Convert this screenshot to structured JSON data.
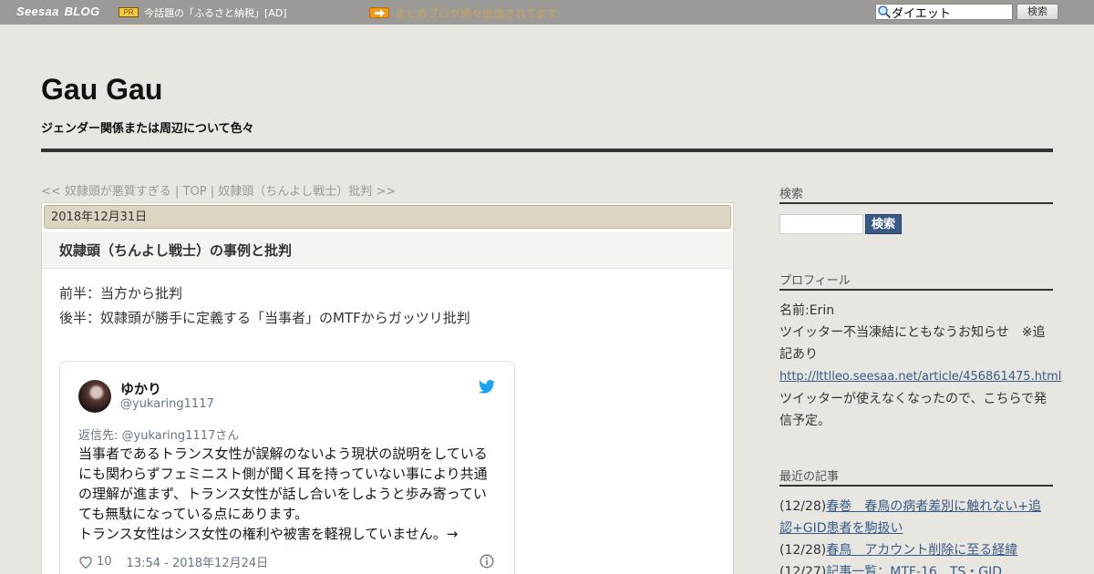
{
  "topbar": {
    "logo_main": "Seesaa",
    "logo_sub": "BLOG",
    "pr_badge": "PR",
    "pr_text": "今話題の「ふるさと納税」[AD]",
    "notice": "まとめブログ続々追加されてます",
    "search_value": "ダイエット",
    "search_button": "検索"
  },
  "header": {
    "title": "Gau Gau",
    "description": "ジェンダー関係または周辺について色々"
  },
  "breadcrumb": {
    "prev": "<< 奴隷頭が悪質すぎる",
    "sep1": " | ",
    "top": "TOP",
    "sep2": " | ",
    "next": "奴隷頭（ちんよし戦士）批判 >>"
  },
  "article": {
    "date": "2018年12月31日",
    "title": "奴隷頭（ちんよし戦士）の事例と批判",
    "lines": [
      "前半：当方から批判",
      "後半：奴隷頭が勝手に定義する「当事者」のMTFからガッツリ批判"
    ]
  },
  "tweet": {
    "name": "ゆかり",
    "handle": "@yukaring1117",
    "reply_to": "返信先: @yukaring1117さん",
    "text": "当事者であるトランス女性が誤解のないよう現状の説明をしているにも関わらずフェミニスト側が聞く耳を持っていない事により共通の理解が進まず、トランス女性が話し合いをしようと歩み寄っていても無駄になっている点にあります。\nトランス女性はシス女性の権利や被害を軽視していません。→",
    "likes": "10",
    "timestamp": "13:54 - 2018年12月24日"
  },
  "sidebar": {
    "search_title": "検索",
    "search_button": "検索",
    "profile_title": "プロフィール",
    "profile_name": "名前:Erin",
    "profile_note": "ツイッター不当凍結にともなうお知らせ　※追記あり",
    "profile_link": "http://lttlleo.seesaa.net/article/456861475.html",
    "profile_after": "ツイッターが使えなくなったので、こちらで発信予定。",
    "recent_title": "最近の記事",
    "recent": [
      {
        "date": "(12/28)",
        "title": "春巻　春鳥の病者差別に触れない+追認+GID患者を駒扱い"
      },
      {
        "date": "(12/28)",
        "title": "春鳥　アカウント削除に至る経緯"
      },
      {
        "date": "(12/27)",
        "title": "記事一覧：MTF-16　TS・GID"
      }
    ]
  },
  "colors": {
    "accent_link": "#3a5a86",
    "topbar_bg": "#9b9a97",
    "page_bg": "#e8e6e1",
    "date_bar_bg": "#dbd5c2",
    "twitter_blue": "#1da1f2"
  }
}
